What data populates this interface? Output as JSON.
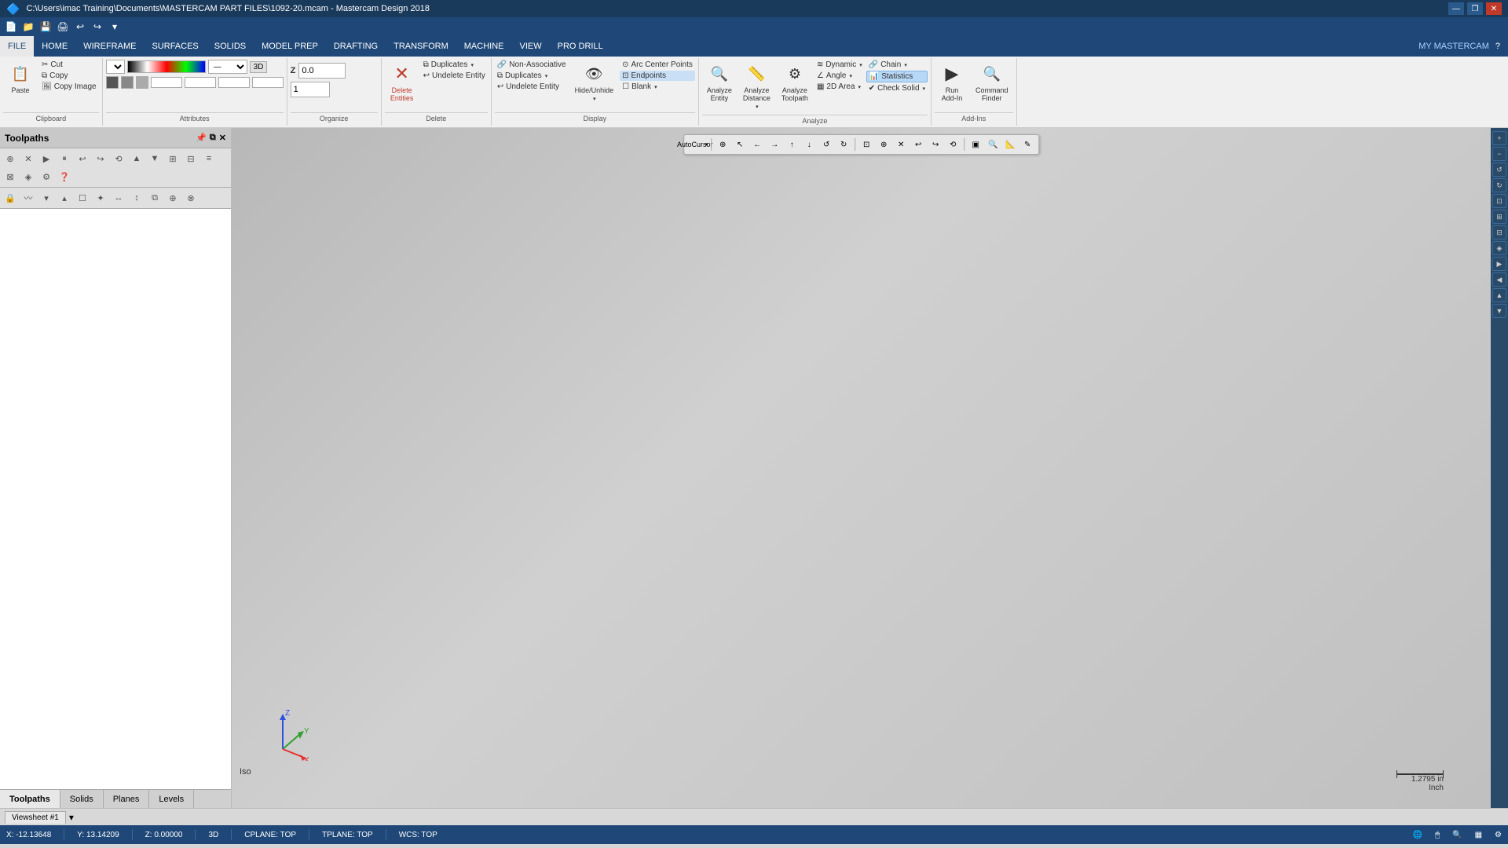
{
  "titleBar": {
    "title": "C:\\Users\\imac Training\\Documents\\MASTERCAM PART FILES\\1092-20.mcam - Mastercam Design 2018",
    "controls": [
      "—",
      "❐",
      "✕"
    ]
  },
  "menuBar": {
    "items": [
      "FILE",
      "HOME",
      "WIREFRAME",
      "SURFACES",
      "SOLIDS",
      "MODEL PREP",
      "DRAFTING",
      "TRANSFORM",
      "MACHINE",
      "VIEW",
      "PRO DRILL"
    ],
    "activeItem": "HOME",
    "right": [
      "MY MASTERCAM",
      "?"
    ]
  },
  "ribbon": {
    "groups": [
      {
        "name": "Clipboard",
        "buttons": [
          {
            "label": "Paste",
            "icon": "📋",
            "large": true
          },
          {
            "label": "Cut",
            "icon": "✂",
            "small": true
          },
          {
            "label": "Copy",
            "icon": "⧉",
            "small": true
          },
          {
            "label": "Copy Image",
            "icon": "🖼",
            "small": true
          }
        ]
      },
      {
        "name": "Attributes",
        "dropdowns": [
          "▼",
          "—",
          "▼",
          "3D"
        ]
      },
      {
        "name": "Organize",
        "zLabel": "Z",
        "zValue": "0.0",
        "spinValue": "1"
      },
      {
        "name": "Delete",
        "buttons": [
          {
            "label": "Delete\nEntities",
            "icon": "✕",
            "large": true
          },
          {
            "label": "Duplicates",
            "icon": "⧉",
            "small": true,
            "dropdown": true
          },
          {
            "label": "Undelete Entity",
            "icon": "↩",
            "small": true
          }
        ]
      },
      {
        "name": "Display",
        "buttons": [
          {
            "label": "Non-Associative",
            "icon": "🔗",
            "small": true
          },
          {
            "label": "Duplicates",
            "icon": "⧉",
            "small": true,
            "dropdown": true
          },
          {
            "label": "Undelete Entity",
            "icon": "↩",
            "small": true
          },
          {
            "label": "Hide/Unhide",
            "icon": "👁",
            "large": true
          },
          {
            "label": "Arc Center Points",
            "icon": "⊙",
            "small": true
          },
          {
            "label": "Endpoints",
            "icon": "⊡",
            "small": true,
            "highlighted": true
          },
          {
            "label": "Blank",
            "icon": "☐",
            "small": true,
            "dropdown": true
          }
        ]
      },
      {
        "name": "Analyze",
        "buttons": [
          {
            "label": "Analyze\nEntity",
            "icon": "🔍",
            "large": true
          },
          {
            "label": "Analyze\nDistance",
            "icon": "📏",
            "large": true,
            "dropdown": true
          },
          {
            "label": "Analyze\nToolpath",
            "icon": "⚙",
            "large": true
          },
          {
            "label": "Dynamic",
            "icon": "≋",
            "small": true,
            "dropdown": true
          },
          {
            "label": "Angle",
            "icon": "∠",
            "small": true,
            "dropdown": true
          },
          {
            "label": "2D Area",
            "icon": "▦",
            "small": true,
            "dropdown": true
          },
          {
            "label": "Chain",
            "icon": "🔗",
            "small": true,
            "dropdown": true
          },
          {
            "label": "Statistics",
            "icon": "📊",
            "small": true,
            "highlighted": true
          },
          {
            "label": "Check Solid",
            "icon": "✔",
            "small": true,
            "dropdown": true
          }
        ]
      },
      {
        "name": "Add-Ins",
        "buttons": [
          {
            "label": "Run\nAdd-In",
            "icon": "▶",
            "large": true
          },
          {
            "label": "Command\nFinder",
            "icon": "🔍",
            "large": true
          }
        ]
      }
    ]
  },
  "toolpaths": {
    "title": "Toolpaths",
    "toolbar": [
      "⊕",
      "✕",
      "▶",
      "⏸",
      "↩",
      "↪",
      "⟲",
      "▲",
      "▼",
      "⊞",
      "⊟",
      "≡",
      "⊠",
      "◈",
      "⚙",
      "❓"
    ],
    "toolbar2": [
      "🔒",
      "〰",
      "▾",
      "▴",
      "☐",
      "✦",
      "↔",
      "↕",
      "⧉",
      "⊕",
      "⊗"
    ]
  },
  "viewport": {
    "isoLabel": "Iso",
    "viewsheet": "Viewsheet #1",
    "scale": "1.2795 in\nInch"
  },
  "cmdToolbar": {
    "buttons": [
      "⊕",
      "↖",
      "←",
      "→",
      "↑",
      "↓",
      "↺",
      "↻",
      "⊡",
      "⊕",
      "✕",
      "↩",
      "↪",
      "⟲",
      "▣",
      "🔍",
      "📐",
      "✎"
    ]
  },
  "statusBar": {
    "x": "X:  -12.13648",
    "y": "Y:  13.14209",
    "z": "Z:  0.00000",
    "mode": "3D",
    "cplane": "CPLANE: TOP",
    "tplane": "TPLANE: TOP",
    "wcs": "WCS: TOP",
    "icons": [
      "🌐",
      "🖱",
      "🔍",
      "☐",
      "⚙"
    ]
  },
  "tabs": [
    {
      "label": "Toolpaths",
      "active": true
    },
    {
      "label": "Solids",
      "active": false
    },
    {
      "label": "Planes",
      "active": false
    },
    {
      "label": "Levels",
      "active": false
    }
  ],
  "axisColors": {
    "x": "#e63030",
    "y": "#30a030",
    "z": "#3050e0"
  }
}
